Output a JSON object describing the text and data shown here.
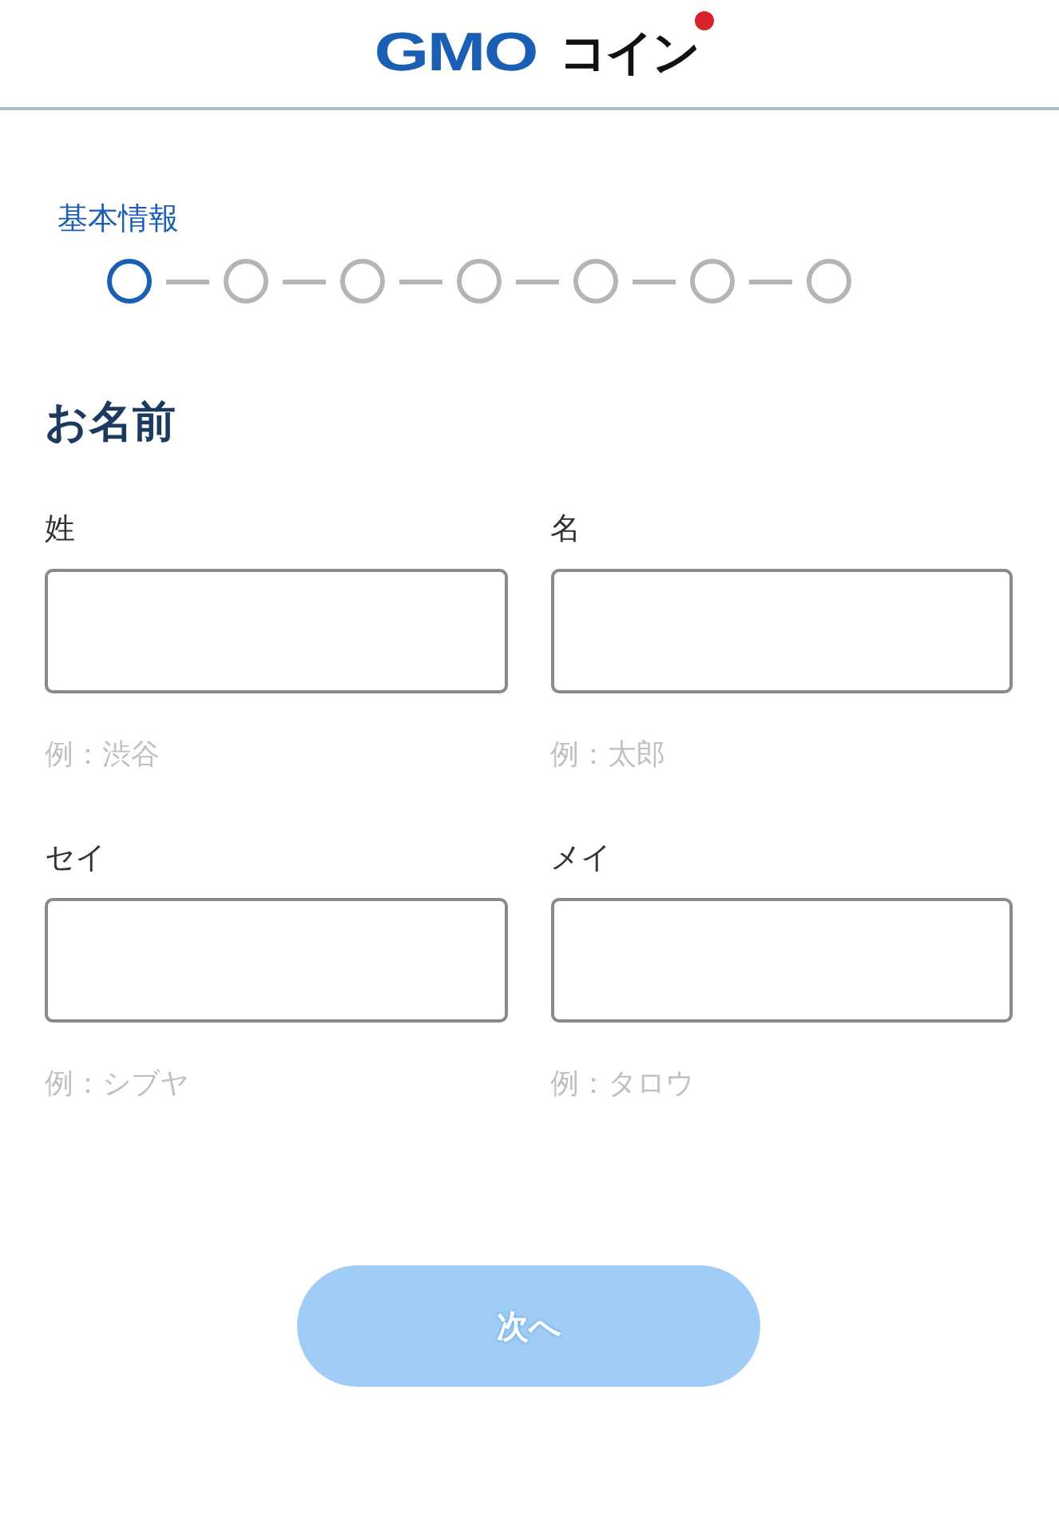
{
  "header": {
    "logo": {
      "brand": "GMO",
      "name": "コイン"
    }
  },
  "progress": {
    "label": "基本情報",
    "steps": [
      {
        "selected": true
      },
      {
        "selected": false
      },
      {
        "selected": false
      },
      {
        "selected": false
      },
      {
        "selected": false
      },
      {
        "selected": false
      },
      {
        "selected": false
      }
    ]
  },
  "section": {
    "title": "お名前"
  },
  "fields": [
    {
      "label": "姓",
      "example": "例：渋谷"
    },
    {
      "label": "名",
      "example": "例：太郎"
    },
    {
      "label": "セイ",
      "example": "例：シブヤ"
    },
    {
      "label": "メイ",
      "example": "例：タロウ"
    }
  ],
  "button": {
    "label": "次へ",
    "disabled": true
  }
}
